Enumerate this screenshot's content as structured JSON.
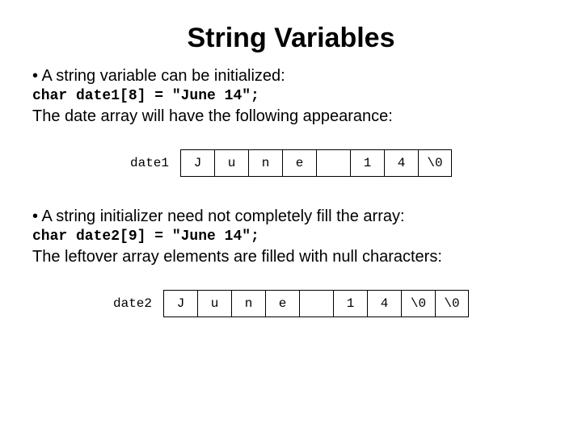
{
  "title": "String Variables",
  "bullet1": "• A string variable can be initialized:",
  "code1": "char date1[8] = \"June 14\";",
  "after1": "The date array will have the following appearance:",
  "array1": {
    "label": "date1",
    "cells": [
      "J",
      "u",
      "n",
      "e",
      " ",
      "1",
      "4",
      "\\0"
    ]
  },
  "bullet2": "• A string initializer need not completely fill the array:",
  "code2": "char date2[9] = \"June 14\";",
  "after2": "The leftover array elements are filled with null characters:",
  "array2": {
    "label": "date2",
    "cells": [
      "J",
      "u",
      "n",
      "e",
      " ",
      "1",
      "4",
      "\\0",
      "\\0"
    ]
  }
}
